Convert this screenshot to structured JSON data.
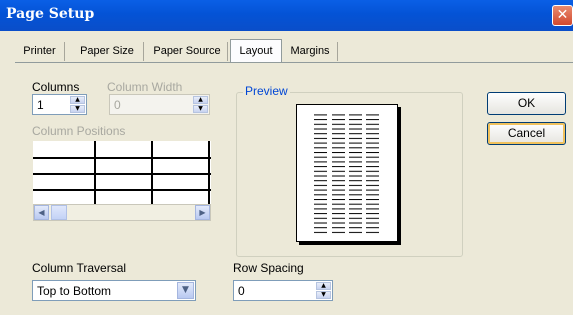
{
  "window": {
    "title": "Page Setup",
    "close_glyph": "✕"
  },
  "tabs": [
    {
      "label": "Printer"
    },
    {
      "label": "Paper Size"
    },
    {
      "label": "Paper Source"
    },
    {
      "label": "Layout"
    },
    {
      "label": "Margins"
    }
  ],
  "active_tab": "Layout",
  "columns": {
    "label": "Columns",
    "value": "1"
  },
  "column_width": {
    "label": "Column Width",
    "value": "0",
    "enabled": false
  },
  "column_positions": {
    "label": "Column Positions",
    "enabled": false
  },
  "preview": {
    "legend": "Preview"
  },
  "column_traversal": {
    "label": "Column Traversal",
    "value": "Top to Bottom"
  },
  "row_spacing": {
    "label": "Row Spacing",
    "value": "0"
  },
  "buttons": {
    "ok": "OK",
    "cancel": "Cancel"
  },
  "icons": {
    "close": "close-icon",
    "spin_up": "arrow-up-icon",
    "spin_down": "arrow-down-icon",
    "scroll_left": "arrow-left-icon",
    "scroll_right": "arrow-right-icon",
    "dropdown": "chevron-down-icon"
  },
  "colors": {
    "titlebar": "#0453d6",
    "preview_legend": "#0046d5",
    "dialog_bg": "#ece9d8"
  }
}
